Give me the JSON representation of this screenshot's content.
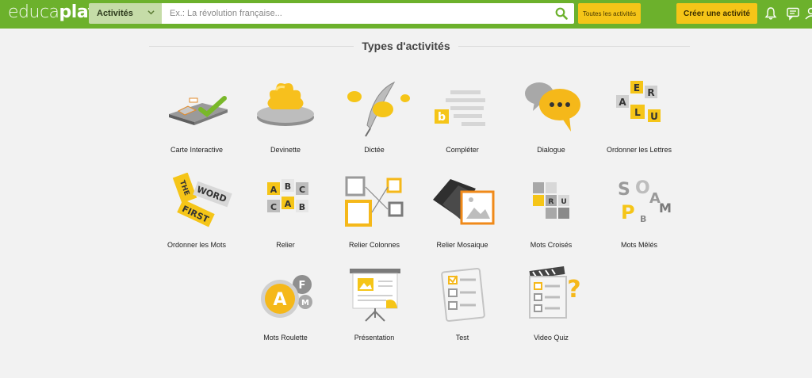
{
  "header": {
    "logo_part1": "educa",
    "logo_part2": "play",
    "category_label": "Activités",
    "search_placeholder": "Ex.: La révolution française...",
    "all_activities_label": "Toutes les activités",
    "create_label": "Créer une activité",
    "colors": {
      "bar": "#6cb12c",
      "accent": "#f5c518"
    }
  },
  "main": {
    "title": "Types d'activités",
    "activities": [
      {
        "label": "Carte Interactive",
        "icon": "map-check-icon"
      },
      {
        "label": "Devinette",
        "icon": "puzzle-piece-icon"
      },
      {
        "label": "Dictée",
        "icon": "quill-speech-icon"
      },
      {
        "label": "Compléter",
        "icon": "text-blocks-icon"
      },
      {
        "label": "Dialogue",
        "icon": "speech-bubbles-icon"
      },
      {
        "label": "Ordonner les Lettres",
        "icon": "letter-tiles-icon"
      },
      {
        "label": "Ordonner les Mots",
        "icon": "word-tiles-icon"
      },
      {
        "label": "Relier",
        "icon": "linked-letter-cubes-icon"
      },
      {
        "label": "Relier Colonnes",
        "icon": "matching-columns-icon"
      },
      {
        "label": "Relier Mosaique",
        "icon": "mosaic-tiles-icon"
      },
      {
        "label": "Mots Croisés",
        "icon": "crossword-icon"
      },
      {
        "label": "Mots Mêlés",
        "icon": "word-search-icon"
      },
      {
        "label": "Mots Roulette",
        "icon": "letter-wheel-icon"
      },
      {
        "label": "Présentation",
        "icon": "presentation-board-icon"
      },
      {
        "label": "Test",
        "icon": "test-checklist-icon"
      },
      {
        "label": "Video Quiz",
        "icon": "video-quiz-icon"
      }
    ]
  }
}
